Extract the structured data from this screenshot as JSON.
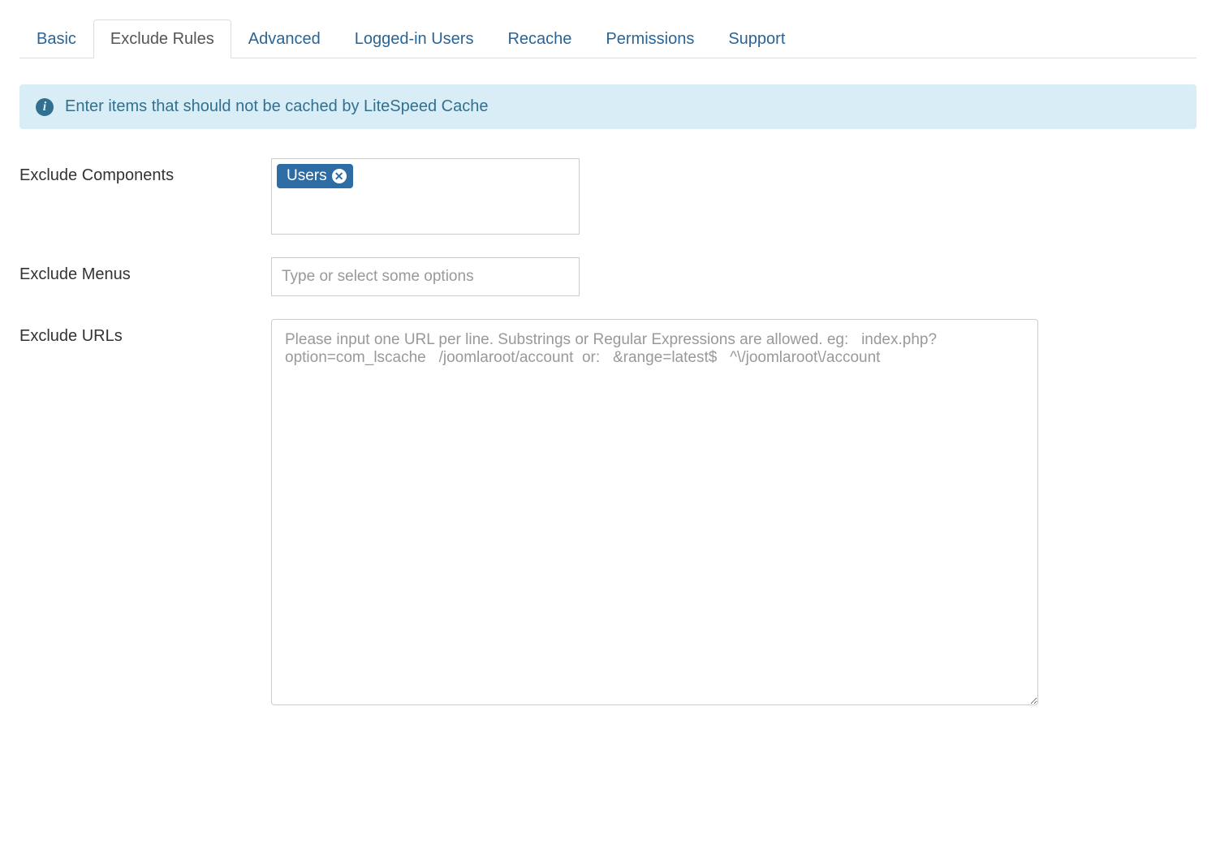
{
  "tabs": {
    "basic": "Basic",
    "exclude_rules": "Exclude Rules",
    "advanced": "Advanced",
    "logged_in_users": "Logged-in Users",
    "recache": "Recache",
    "permissions": "Permissions",
    "support": "Support",
    "active": "exclude_rules"
  },
  "alert": {
    "text": "Enter items that should not be cached by LiteSpeed Cache"
  },
  "fields": {
    "exclude_components": {
      "label": "Exclude Components",
      "tags": [
        "Users"
      ]
    },
    "exclude_menus": {
      "label": "Exclude Menus",
      "placeholder": "Type or select some options"
    },
    "exclude_urls": {
      "label": "Exclude URLs",
      "placeholder": "Please input one URL per line. Substrings or Regular Expressions are allowed. eg:   index.php?option=com_lscache   /joomlaroot/account  or:   &range=latest$   ^\\/joomlaroot\\/account",
      "value": ""
    }
  }
}
